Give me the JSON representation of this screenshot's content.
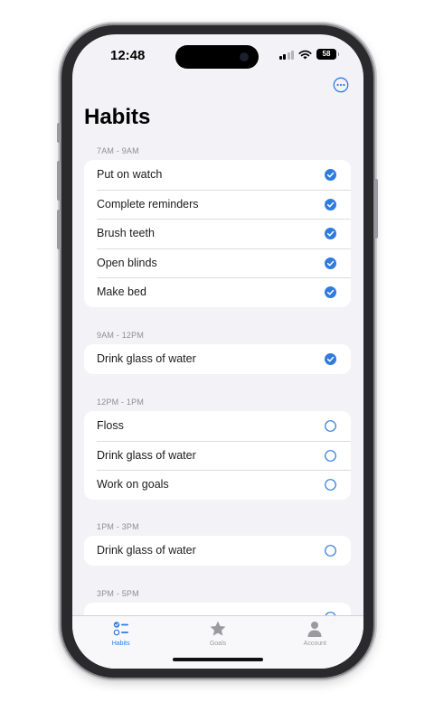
{
  "status": {
    "time": "12:48",
    "battery": "58"
  },
  "title": "Habits",
  "accent": "#2f7be0",
  "sections": [
    {
      "label": "7AM - 9AM",
      "items": [
        {
          "label": "Put on watch",
          "done": true
        },
        {
          "label": "Complete reminders",
          "done": true
        },
        {
          "label": "Brush teeth",
          "done": true
        },
        {
          "label": "Open blinds",
          "done": true
        },
        {
          "label": "Make bed",
          "done": true
        }
      ]
    },
    {
      "label": "9AM - 12PM",
      "items": [
        {
          "label": "Drink glass of water",
          "done": true
        }
      ]
    },
    {
      "label": "12PM - 1PM",
      "items": [
        {
          "label": "Floss",
          "done": false
        },
        {
          "label": "Drink glass of water",
          "done": false
        },
        {
          "label": "Work on goals",
          "done": false
        }
      ]
    },
    {
      "label": "1PM - 3PM",
      "items": [
        {
          "label": "Drink glass of water",
          "done": false
        }
      ]
    },
    {
      "label": "3PM - 5PM",
      "items": []
    }
  ],
  "tabs": [
    {
      "label": "Habits",
      "icon": "habits-checklist-icon",
      "active": true
    },
    {
      "label": "Goals",
      "icon": "star-icon",
      "active": false
    },
    {
      "label": "Account",
      "icon": "person-icon",
      "active": false
    }
  ]
}
